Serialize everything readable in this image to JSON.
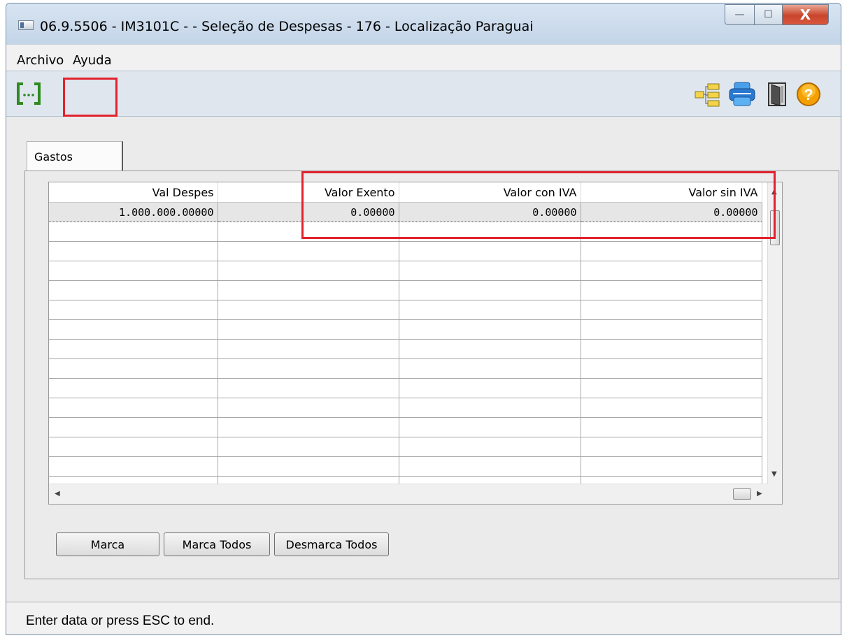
{
  "window": {
    "title": "06.9.5506 - IM3101C -  - Seleção de Despesas - 176 - Localização Paraguai",
    "minimize_glyph": "—",
    "maximize_glyph": "☐",
    "close_glyph": "X"
  },
  "menubar": {
    "items": [
      {
        "label": "Archivo"
      },
      {
        "label": "Ayuda"
      }
    ]
  },
  "toolbar": {
    "left_button_glyph": "[···]",
    "right_icons": [
      "tree-icon",
      "printer-icon",
      "exit-door-icon",
      "help-icon"
    ],
    "help_glyph": "?"
  },
  "tab": {
    "label": "Gastos"
  },
  "grid": {
    "columns": [
      "Val Despes",
      "Valor Exento",
      "Valor con IVA",
      "Valor sin IVA"
    ],
    "rows": [
      [
        "1.000.000.00000",
        "0.00000",
        "0.00000",
        "0.00000"
      ]
    ]
  },
  "buttons": {
    "marca": "Marca",
    "marca_todos": "Marca Todos",
    "desmarca_todos": "Desmarca Todos"
  },
  "status": {
    "text": "Enter data or press ESC to end."
  },
  "colors": {
    "highlight_box": "#e2222d",
    "title_bar": "#c4d5e8",
    "close_button": "#c9442b",
    "help_icon": "#f4a000",
    "printer_icon": "#2a78d0"
  }
}
